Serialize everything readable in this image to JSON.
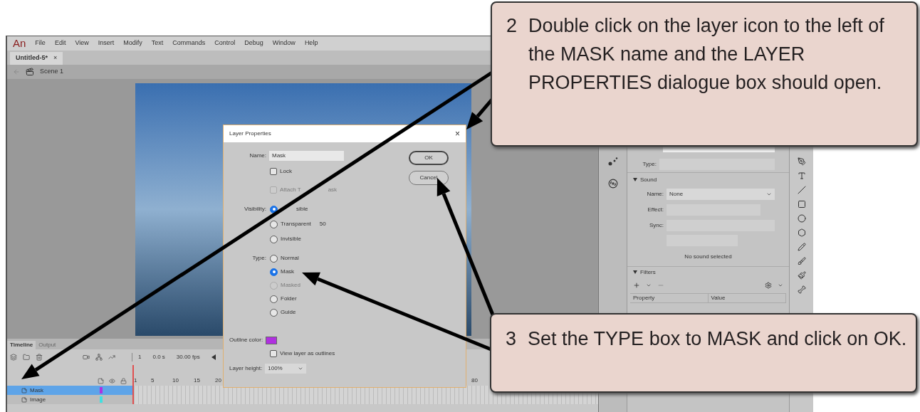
{
  "menu": {
    "logo": "An",
    "items": [
      "File",
      "Edit",
      "View",
      "Insert",
      "Modify",
      "Text",
      "Commands",
      "Control",
      "Debug",
      "Window",
      "Help"
    ]
  },
  "document_tabs": [
    {
      "label": "Untitled-5*",
      "close": "×",
      "selected": true
    }
  ],
  "scene": {
    "label": "Scene 1"
  },
  "properties": {
    "type_label": "Type:",
    "sound_header": "Sound",
    "sound_name_label": "Name:",
    "sound_name_value": "None",
    "effect_label": "Effect:",
    "sync_label": "Sync:",
    "no_sound": "No sound selected",
    "filters_header": "Filters",
    "columns": [
      "Property",
      "Value"
    ]
  },
  "timeline": {
    "tabs": [
      {
        "label": "Timeline",
        "selected": true
      },
      {
        "label": "Output",
        "selected": false
      }
    ],
    "frame": "1",
    "time": "0.0 s",
    "fps": "30.00 fps",
    "ruler": [
      "1",
      "5",
      "10",
      "15",
      "20",
      "80"
    ],
    "layers": [
      {
        "name": "Mask",
        "selected": true,
        "color": "#b030e0"
      },
      {
        "name": "Image",
        "selected": false,
        "color": "#40e0e0"
      }
    ]
  },
  "dialog": {
    "title": "Layer Properties",
    "close": "×",
    "name_label": "Name:",
    "name_value": "Mask",
    "lock": {
      "label": "Lock",
      "checked": false
    },
    "attach": {
      "label_parts": [
        "Attach T",
        "ask"
      ],
      "checked": false,
      "disabled": true
    },
    "visibility_label": "Visibility:",
    "visibility": [
      {
        "label": "sible",
        "selected": true
      },
      {
        "label": "Transparent",
        "selected": false,
        "value": "50"
      },
      {
        "label": "Invisible",
        "selected": false
      }
    ],
    "type_label": "Type:",
    "types": [
      {
        "label": "Normal",
        "selected": false,
        "disabled": false
      },
      {
        "label": "Mask",
        "selected": true,
        "disabled": false
      },
      {
        "label": "Masked",
        "selected": false,
        "disabled": true
      },
      {
        "label": "Folder",
        "selected": false,
        "disabled": false
      },
      {
        "label": "Guide",
        "selected": false,
        "disabled": false
      }
    ],
    "outline": {
      "label": "Outline color:",
      "color": "#b030e0"
    },
    "outlines": {
      "label": "View layer as outlines",
      "checked": false
    },
    "height_label": "Layer height:",
    "height_value": "100%",
    "buttons": [
      {
        "label": "OK",
        "default": true
      },
      {
        "label": "Cancel",
        "default": false
      }
    ]
  },
  "callouts": [
    {
      "number": "2",
      "text": "Double click on the layer icon to the left of the MASK name and the LAYER PROPERTIES dialogue box should open."
    },
    {
      "number": "3",
      "text": "Set the TYPE box to MASK and click on OK."
    }
  ]
}
